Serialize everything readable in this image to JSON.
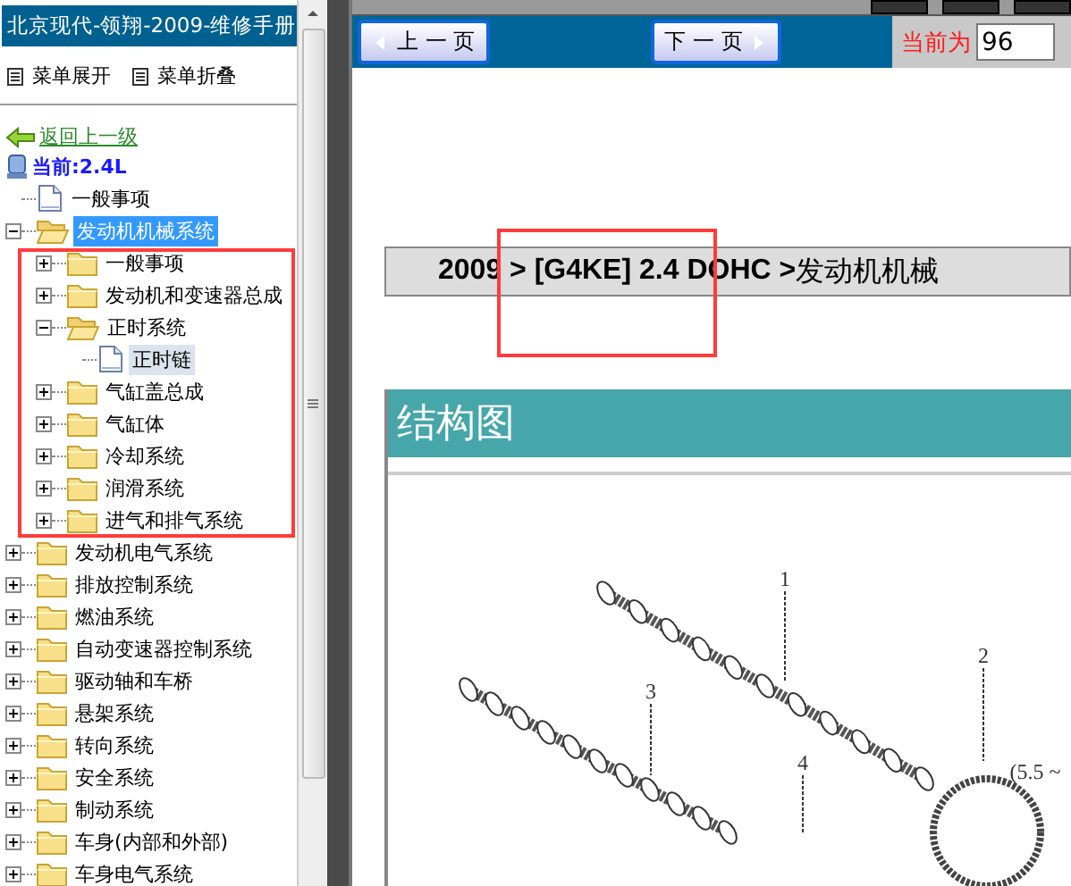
{
  "sidebar": {
    "title": "北京现代-领翔-2009-维修手册",
    "menu": [
      {
        "label": "菜单展开"
      },
      {
        "label": "菜单折叠"
      }
    ],
    "back_link": "返回上一级",
    "current": "当前:2.4L",
    "tree": [
      {
        "label": "一般事项",
        "kind": "doc",
        "selected": false
      },
      {
        "label": "发动机机械系统",
        "kind": "folder",
        "expanded": true,
        "selected": true,
        "children": [
          {
            "label": "一般事项",
            "kind": "folder",
            "expanded": false,
            "selected": false
          },
          {
            "label": "发动机和变速器总成",
            "kind": "folder",
            "expanded": false,
            "selected": false
          },
          {
            "label": "正时系统",
            "kind": "folder",
            "expanded": true,
            "selected": false,
            "children": [
              {
                "label": "正时链",
                "kind": "doc",
                "selected": false,
                "highlighted": true
              }
            ]
          },
          {
            "label": "气缸盖总成",
            "kind": "folder",
            "expanded": false,
            "selected": false
          },
          {
            "label": "气缸体",
            "kind": "folder",
            "expanded": false,
            "selected": false
          },
          {
            "label": "冷却系统",
            "kind": "folder",
            "expanded": false,
            "selected": false
          },
          {
            "label": "润滑系统",
            "kind": "folder",
            "expanded": false,
            "selected": false
          },
          {
            "label": "进气和排气系统",
            "kind": "folder",
            "expanded": false,
            "selected": false
          }
        ]
      },
      {
        "label": "发动机电气系统",
        "kind": "folder",
        "expanded": false,
        "selected": false
      },
      {
        "label": "排放控制系统",
        "kind": "folder",
        "expanded": false,
        "selected": false
      },
      {
        "label": "燃油系统",
        "kind": "folder",
        "expanded": false,
        "selected": false
      },
      {
        "label": "自动变速器控制系统",
        "kind": "folder",
        "expanded": false,
        "selected": false
      },
      {
        "label": "驱动轴和车桥",
        "kind": "folder",
        "expanded": false,
        "selected": false
      },
      {
        "label": "悬架系统",
        "kind": "folder",
        "expanded": false,
        "selected": false
      },
      {
        "label": "转向系统",
        "kind": "folder",
        "expanded": false,
        "selected": false
      },
      {
        "label": "安全系统",
        "kind": "folder",
        "expanded": false,
        "selected": false
      },
      {
        "label": "制动系统",
        "kind": "folder",
        "expanded": false,
        "selected": false
      },
      {
        "label": "车身(内部和外部)",
        "kind": "folder",
        "expanded": false,
        "selected": false
      },
      {
        "label": "车身电气系统",
        "kind": "folder",
        "expanded": false,
        "selected": false
      }
    ]
  },
  "nav": {
    "prev": "上 一 页",
    "next": "下 一 页",
    "page_label": "当前为",
    "page_value": "96"
  },
  "document": {
    "breadcrumb_bold": "2009 > [G4KE] 2.4 DOHC >",
    "breadcrumb_rest": "发动机机械",
    "section_title": "结构图",
    "callouts": [
      "1",
      "2",
      "3",
      "4",
      "(5.5 ~"
    ]
  }
}
